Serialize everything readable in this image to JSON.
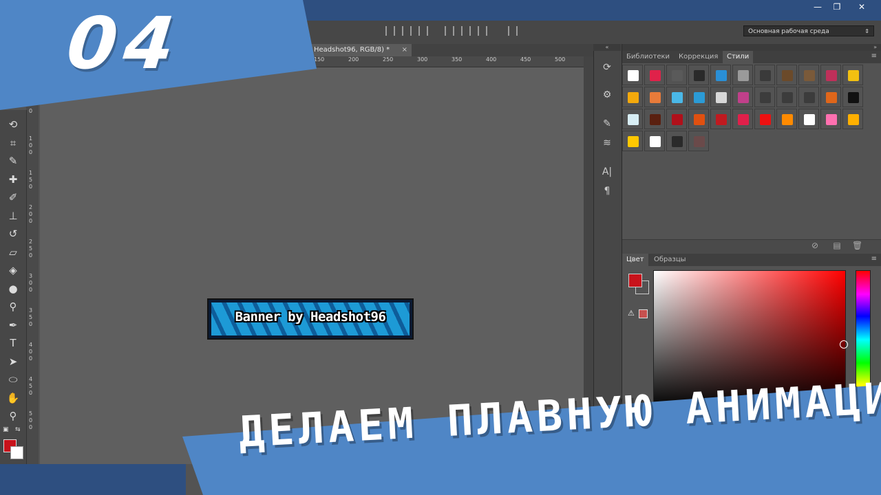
{
  "window": {
    "minimize_icon": "minimize-icon",
    "maximize_icon": "maximize-icon",
    "close_icon": "close-icon",
    "minimize": "—",
    "maximize": "❐",
    "close": "✕"
  },
  "options_bar": {
    "workspace": "Основная рабочая среда"
  },
  "document": {
    "tab_title": "Headshot96, RGB/8) *",
    "tab_close": "×",
    "ruler_h": [
      "150",
      "200",
      "250",
      "300",
      "350",
      "400",
      "450",
      "500"
    ],
    "ruler_v": [
      "0",
      "5 0",
      "1 0 0",
      "1 5 0",
      "2 0 0",
      "2 5 0",
      "3 0 0",
      "3 5 0",
      "4 0 0",
      "4 5 0",
      "5 0 0"
    ],
    "banner_text": "Banner by Headshot96"
  },
  "tools": [
    {
      "name": "lasso-tool-icon",
      "glyph": "⟲"
    },
    {
      "name": "crop-tool-icon",
      "glyph": "⌗"
    },
    {
      "name": "eyedropper-tool-icon",
      "glyph": "✎"
    },
    {
      "name": "healing-brush-icon",
      "glyph": "✚"
    },
    {
      "name": "brush-tool-icon",
      "glyph": "✐"
    },
    {
      "name": "clone-stamp-icon",
      "glyph": "⊥"
    },
    {
      "name": "history-brush-icon",
      "glyph": "↺"
    },
    {
      "name": "eraser-tool-icon",
      "glyph": "▱"
    },
    {
      "name": "paint-bucket-icon",
      "glyph": "◈"
    },
    {
      "name": "blur-tool-icon",
      "glyph": "●"
    },
    {
      "name": "dodge-tool-icon",
      "glyph": "⚲"
    },
    {
      "name": "pen-tool-icon",
      "glyph": "✒"
    },
    {
      "name": "type-tool-icon",
      "glyph": "T"
    },
    {
      "name": "path-selection-icon",
      "glyph": "➤"
    },
    {
      "name": "ellipse-tool-icon",
      "glyph": "⬭"
    },
    {
      "name": "hand-tool-icon",
      "glyph": "✋"
    },
    {
      "name": "zoom-tool-icon",
      "glyph": "⚲"
    }
  ],
  "dock": [
    {
      "name": "history-panel-icon",
      "glyph": "⟳"
    },
    {
      "name": "actions-panel-icon",
      "glyph": "⚙"
    },
    {
      "name": "brush-panel-icon",
      "glyph": "✎"
    },
    {
      "name": "brush-presets-icon",
      "glyph": "≋"
    },
    {
      "name": "character-panel-icon",
      "glyph": "A|"
    },
    {
      "name": "paragraph-panel-icon",
      "glyph": "¶"
    }
  ],
  "styles_panel": {
    "tabs": [
      "Библиотеки",
      "Коррекция",
      "Стили"
    ],
    "active_tab": 2,
    "swatch_colors": [
      "#ffffff",
      "#e0224a",
      "#5a5a5a",
      "#2a2a2a",
      "#2a8fd6",
      "#9a9a9a",
      "#3a3a3a",
      "#6b4a2a",
      "#7a5a3a",
      "#c0305a",
      "#f2c011",
      "#f4a90c",
      "#e87b3a",
      "#4ab8e8",
      "#2b9bd6",
      "#d8d8d8",
      "#c0408a",
      "#3c3c3c",
      "#3c3c3c",
      "#3c3c3c",
      "#e0661a",
      "#111111",
      "#d8eef5",
      "#5a2010",
      "#b0101a",
      "#e05010",
      "#c01a20",
      "#e0204a",
      "#ee1111",
      "#ff8a00",
      "#ffffff",
      "#ff70b0",
      "#ffb000",
      "#ffc800",
      "#ffffff",
      "#2a2a2a",
      "#6a4a4a"
    ]
  },
  "color_panel": {
    "tabs": [
      "Цвет",
      "Образцы"
    ],
    "warning_glyph": "⚠"
  },
  "overlay": {
    "episode_number": "04",
    "title": "ДЕЛАЕМ ПЛАВНУЮ АНИМАЦИЮ"
  }
}
